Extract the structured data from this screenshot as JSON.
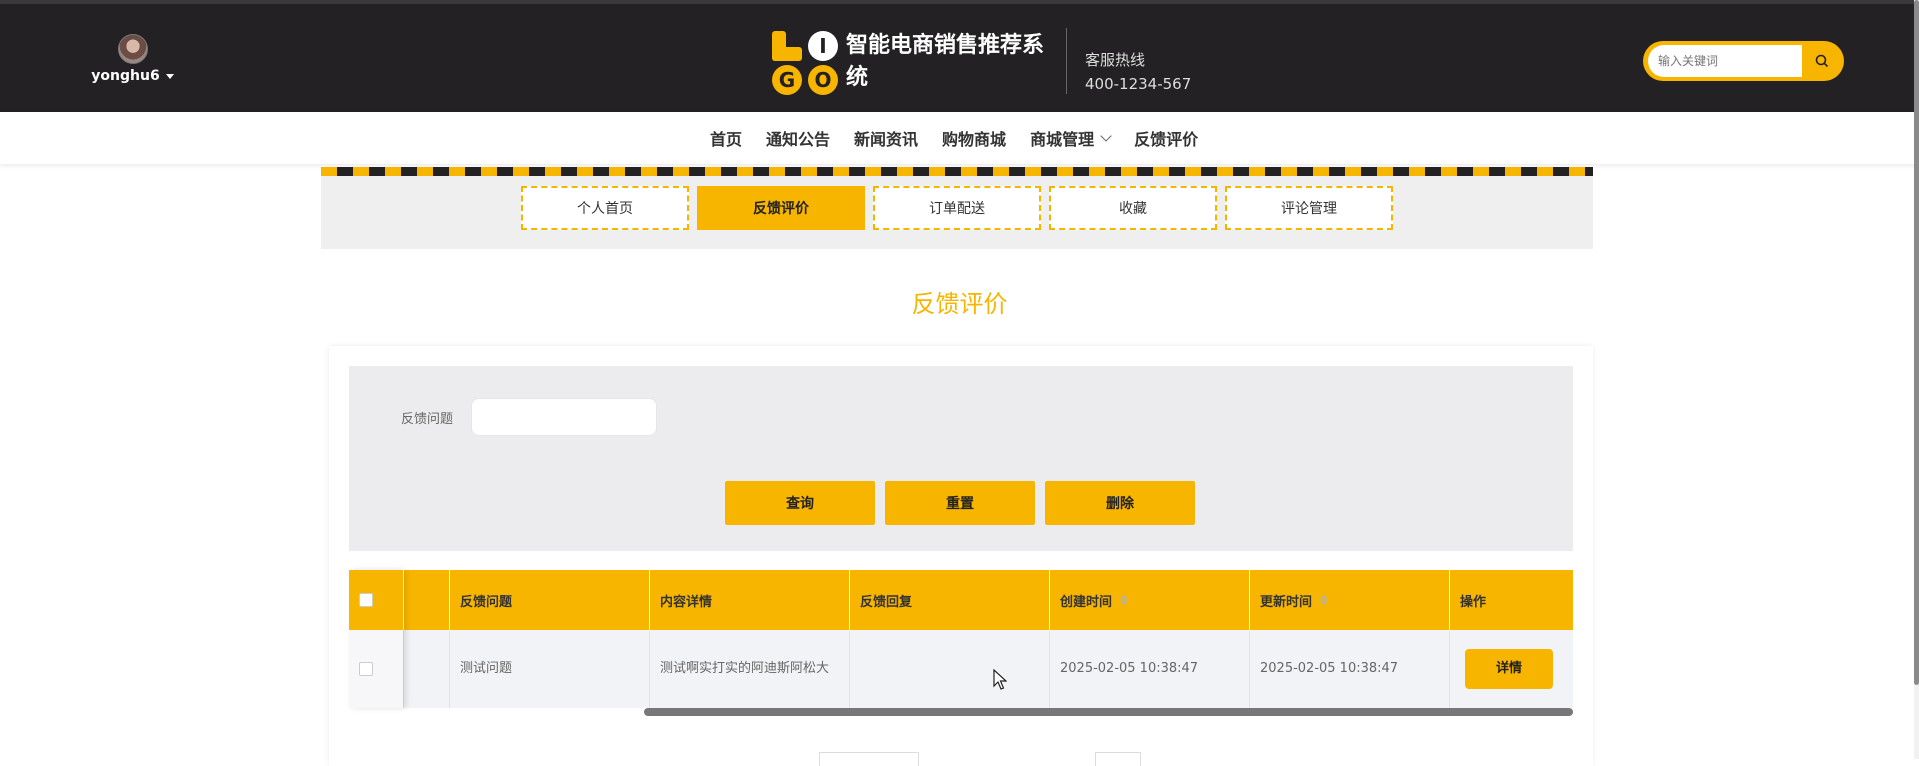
{
  "header": {
    "username": "yonghu6",
    "logo_letters": [
      "L",
      "I",
      "G",
      "O"
    ],
    "site_title": "智能电商销售推荐系统",
    "hotline_label": "客服热线",
    "hotline_number": "400-1234-567",
    "search_placeholder": "输入关键词",
    "accent_color": "#f7b500",
    "dark_color": "#232123"
  },
  "nav": {
    "items": [
      {
        "label": "首页"
      },
      {
        "label": "通知公告"
      },
      {
        "label": "新闻资讯"
      },
      {
        "label": "购物商城"
      },
      {
        "label": "商城管理"
      },
      {
        "label": "反馈评价"
      }
    ]
  },
  "subtabs": [
    {
      "label": "个人首页",
      "active": false
    },
    {
      "label": "反馈评价",
      "active": true
    },
    {
      "label": "订单配送",
      "active": false
    },
    {
      "label": "收藏",
      "active": false
    },
    {
      "label": "评论管理",
      "active": false
    }
  ],
  "page_title": "反馈评价",
  "filter": {
    "label": "反馈问题",
    "value": "",
    "buttons": {
      "query": "查询",
      "reset": "重置",
      "delete": "删除"
    }
  },
  "table": {
    "headers": {
      "issue": "反馈问题",
      "content": "内容详情",
      "reply": "反馈回复",
      "created": "创建时间",
      "updated": "更新时间",
      "action": "操作"
    },
    "rows": [
      {
        "issue": "测试问题",
        "content": "测试啊实打实的阿迪斯阿松大",
        "reply": "",
        "created": "2025-02-05 10:38:47",
        "updated": "2025-02-05 10:38:47",
        "action": "详情"
      }
    ]
  }
}
